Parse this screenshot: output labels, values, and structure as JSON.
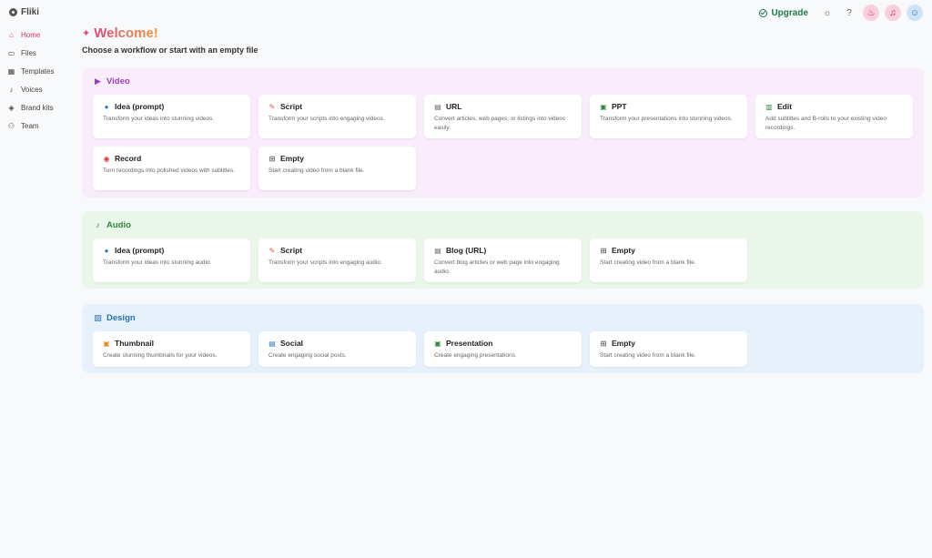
{
  "app": {
    "name": "Fliki"
  },
  "topbar": {
    "upgrade_label": "Upgrade"
  },
  "sidebar": {
    "items": [
      {
        "label": "Home",
        "icon": "home-icon",
        "glyph": "⌂"
      },
      {
        "label": "Files",
        "icon": "folder-icon",
        "glyph": "▭"
      },
      {
        "label": "Templates",
        "icon": "templates-icon",
        "glyph": "▦"
      },
      {
        "label": "Voices",
        "icon": "voices-icon",
        "glyph": "♪"
      },
      {
        "label": "Brand kits",
        "icon": "brand-kits-icon",
        "glyph": "◈"
      },
      {
        "label": "Team",
        "icon": "team-icon",
        "glyph": "⚇"
      }
    ]
  },
  "main": {
    "title": "Welcome!",
    "subtitle": "Choose a workflow or start with an empty file"
  },
  "sections": {
    "video": {
      "title": "Video",
      "cards": [
        {
          "title": "Idea (prompt)",
          "desc": "Transform your ideas into stunning videos."
        },
        {
          "title": "Script",
          "desc": "Transform your scripts into engaging videos."
        },
        {
          "title": "URL",
          "desc": "Convert articles, web pages, or listings into videos easily."
        },
        {
          "title": "PPT",
          "desc": "Transform your presentations into stunning videos."
        },
        {
          "title": "Edit",
          "desc": "Add subtitles and B-rolls to your existing video recordings."
        },
        {
          "title": "Record",
          "desc": "Turn recordings into polished videos with subtitles."
        },
        {
          "title": "Empty",
          "desc": "Start creating video from a blank file."
        }
      ]
    },
    "audio": {
      "title": "Audio",
      "cards": [
        {
          "title": "Idea (prompt)",
          "desc": "Transform your ideas into stunning audio."
        },
        {
          "title": "Script",
          "desc": "Transform your scripts into engaging audio."
        },
        {
          "title": "Blog (URL)",
          "desc": "Convert blog articles or web page into engaging audio."
        },
        {
          "title": "Empty",
          "desc": "Start creating video from a blank file."
        }
      ]
    },
    "design": {
      "title": "Design",
      "cards": [
        {
          "title": "Thumbnail",
          "desc": "Create stunning thumbnails for your videos."
        },
        {
          "title": "Social",
          "desc": "Create engaging social posts."
        },
        {
          "title": "Presentation",
          "desc": "Create engaging presentations."
        },
        {
          "title": "Empty",
          "desc": "Start creating video from a blank file."
        }
      ]
    }
  }
}
